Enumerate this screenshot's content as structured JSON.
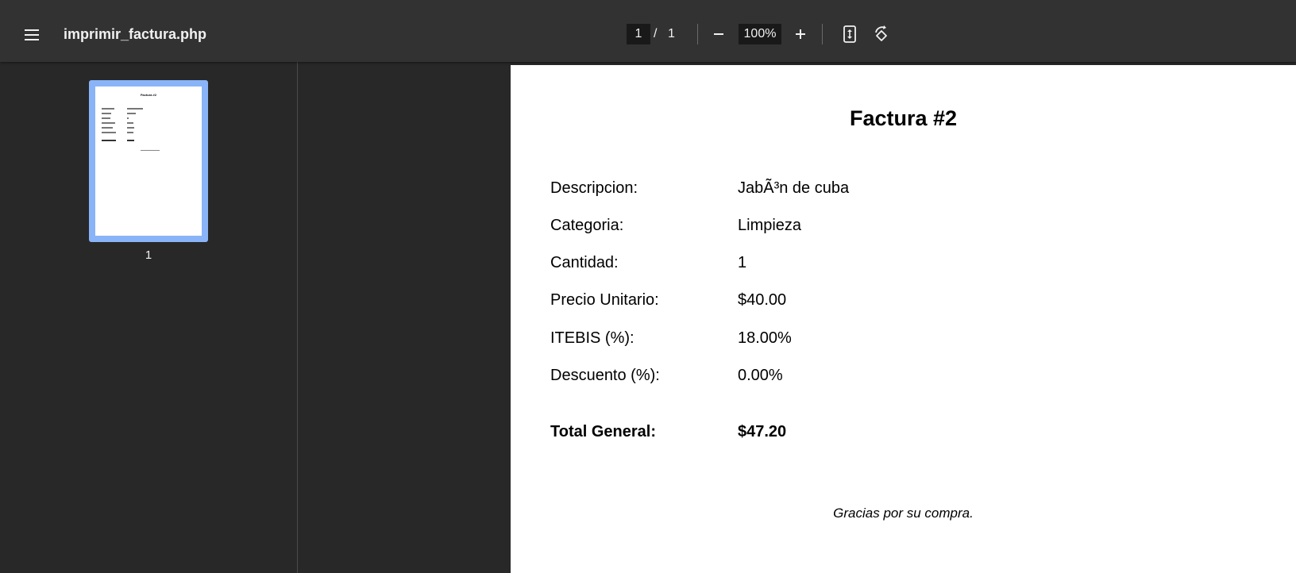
{
  "toolbar": {
    "title": "imprimir_factura.php",
    "page_current": "1",
    "page_separator": "/",
    "page_total": "1",
    "zoom": "100%",
    "icons": [
      "menu-icon",
      "zoom-out-icon",
      "zoom-in-icon",
      "fit-page-icon",
      "rotate-icon"
    ]
  },
  "sidebar": {
    "thumbnail_page_number": "1"
  },
  "invoice": {
    "title": "Factura #2",
    "rows": [
      {
        "label": "Descripcion:",
        "value": "JabÃ³n de cuba"
      },
      {
        "label": "Categoria:",
        "value": "Limpieza"
      },
      {
        "label": "Cantidad:",
        "value": "1"
      },
      {
        "label": "Precio Unitario:",
        "value": "$40.00"
      },
      {
        "label": "ITEBIS (%):",
        "value": "18.00%"
      },
      {
        "label": "Descuento (%):",
        "value": "0.00%"
      }
    ],
    "total": {
      "label": "Total General:",
      "value": "$47.20"
    },
    "footer": "Gracias por su compra."
  },
  "colors": {
    "toolbar_bg": "#323232",
    "viewer_bg": "#282828",
    "thumb_selected": "#8ab4f8"
  }
}
